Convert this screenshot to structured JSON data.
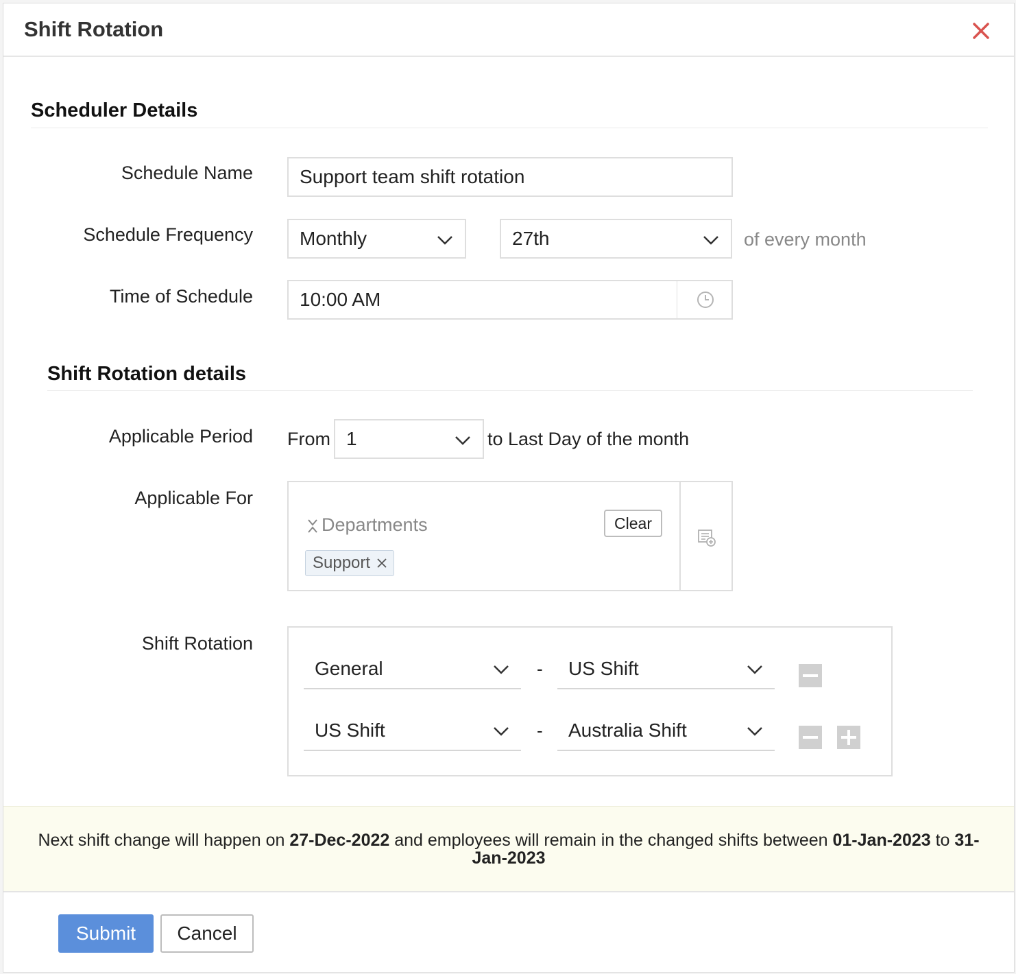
{
  "dialog": {
    "title": "Shift Rotation"
  },
  "scheduler": {
    "section_title": "Scheduler Details",
    "name_label": "Schedule Name",
    "name_value": "Support team shift rotation",
    "frequency_label": "Schedule Frequency",
    "frequency_value": "Monthly",
    "day_value": "27th",
    "day_suffix": "of every month",
    "time_label": "Time of Schedule",
    "time_value": "10:00 AM"
  },
  "rotation_details": {
    "section_title": "Shift Rotation details",
    "period_label": "Applicable Period",
    "from_label": "From",
    "from_value": "1",
    "period_suffix": "to Last Day of the month",
    "applicable_for_label": "Applicable For",
    "applicable_type": "Departments",
    "clear_label": "Clear",
    "tags": [
      "Support"
    ],
    "shift_rotation_label": "Shift Rotation",
    "rows": [
      {
        "from": "General",
        "separator": "-",
        "to": "US Shift"
      },
      {
        "from": "US Shift",
        "separator": "-",
        "to": "Australia Shift"
      }
    ]
  },
  "info": {
    "prefix": "Next shift change will happen on ",
    "date": "27-Dec-2022",
    "middle": " and employees will remain in the changed shifts between ",
    "range_start": "01-Jan-2023",
    "range_to": " to ",
    "range_end": "31-Jan-2023"
  },
  "footer": {
    "submit_label": "Submit",
    "cancel_label": "Cancel"
  },
  "colors": {
    "primary": "#5b8fdb",
    "close": "#d9534f",
    "info_bg": "#fcfcef"
  },
  "icons": [
    "close-icon",
    "chevron-down-icon",
    "clock-icon",
    "list-add-icon",
    "remove-icon",
    "add-icon"
  ]
}
